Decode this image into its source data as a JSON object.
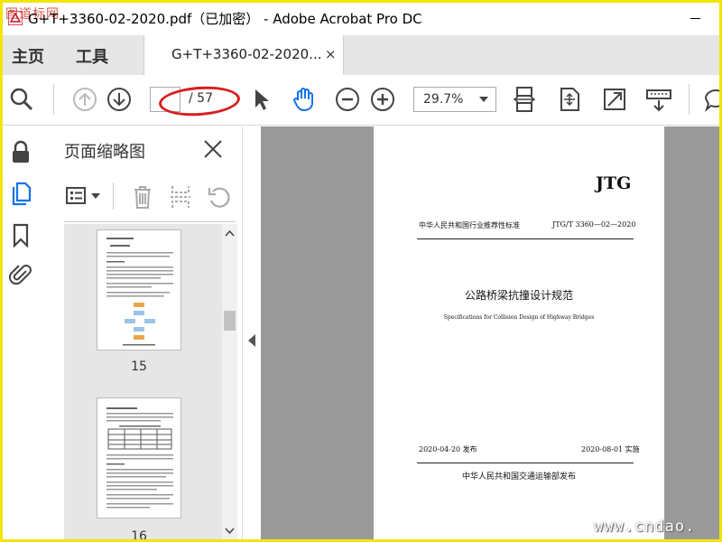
{
  "titlebar": {
    "title": "G+T+3360-02-2020.pdf（已加密） - Adobe Acrobat Pro DC",
    "watermark": "图道标网"
  },
  "nav": {
    "home": "主页",
    "tools": "工具",
    "doc_tab": "G+T+3360-02-2020...",
    "doc_tab_close": "×"
  },
  "toolbar": {
    "page_current": "",
    "page_total": "/ 57",
    "zoom": "29.7%",
    "icons": [
      "search-icon",
      "page-up-icon",
      "page-down-icon",
      "select-cursor-icon",
      "hand-tool-icon",
      "zoom-out-icon",
      "zoom-in-icon",
      "scroll-mode-icon",
      "fit-page-icon",
      "fullscreen-icon",
      "read-mode-icon",
      "comment-icon"
    ]
  },
  "left_rail": {
    "icons": [
      "lock-icon",
      "page-thumbnails-icon",
      "bookmark-icon",
      "attachment-icon"
    ]
  },
  "panel": {
    "title": "页面缩略图",
    "thumbs": [
      {
        "label": "15"
      },
      {
        "label": "16"
      }
    ]
  },
  "document": {
    "jtg": "JTG",
    "std_type": "中华人民共和国行业推荐性标准",
    "std_code": "JTG/T 3360—02—2020",
    "cn_title": "公路桥梁抗撞设计规范",
    "en_title": "Specifications for Collision Design of Highway Bridges",
    "issue_date": "2020-04-20 发布",
    "impl_date": "2020-08-01 实施",
    "publisher": "中华人民共和国交通运输部发布"
  },
  "watermark_bottom": "www.cndao.",
  "colors": {
    "frame": "#f2e600",
    "hand_tool": "#1473e6",
    "annotation": "#d81e1e",
    "doc_bg": "#9a9a9a"
  }
}
